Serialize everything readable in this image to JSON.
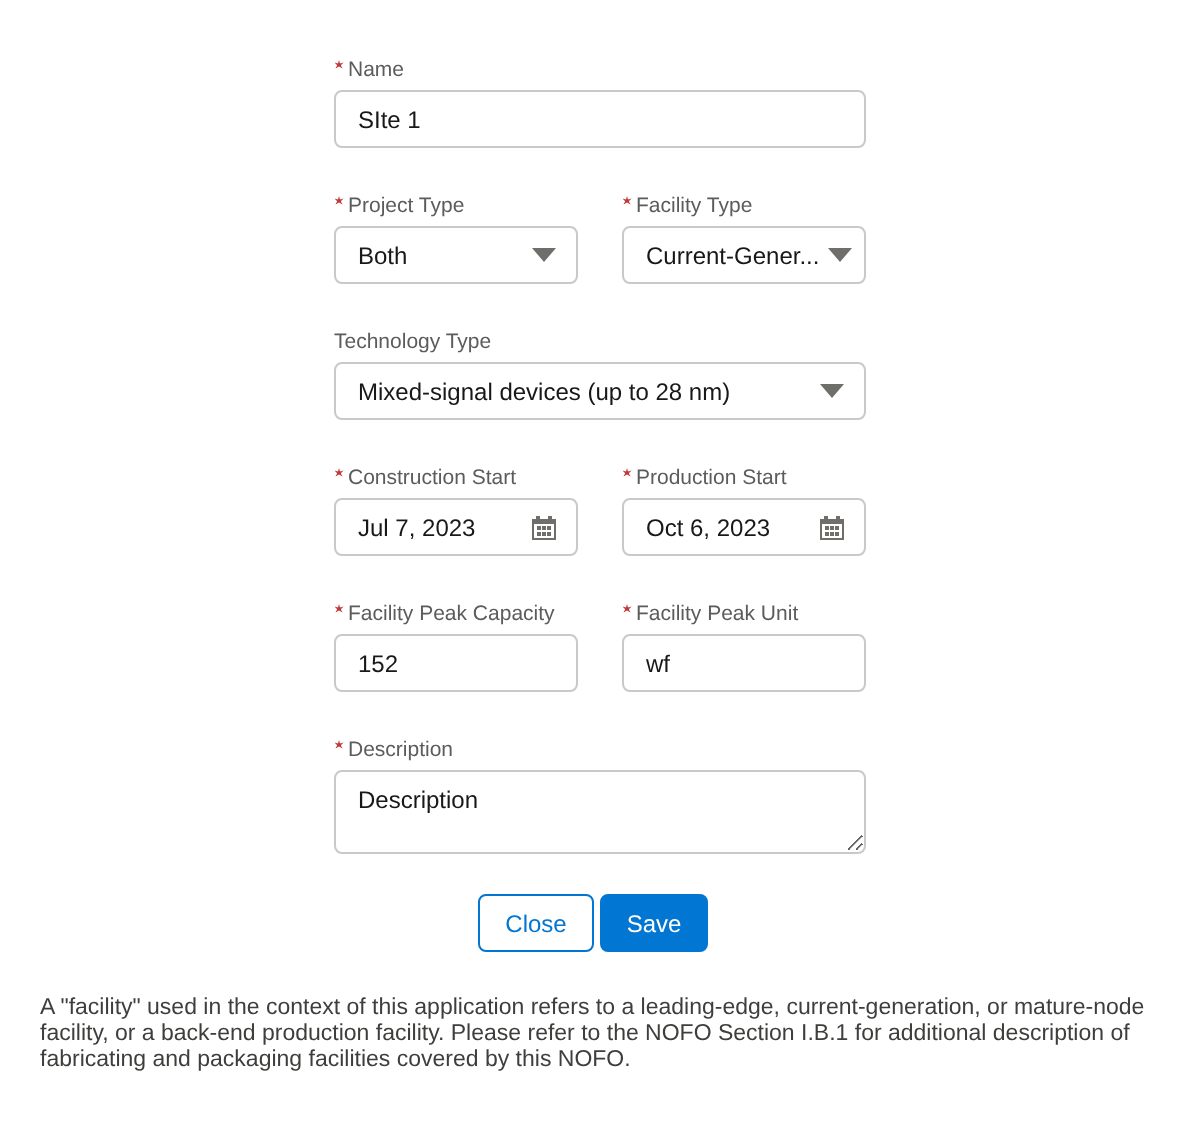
{
  "form": {
    "rows": [
      {
        "fields": [
          {
            "kind": "text",
            "label": "Name",
            "required": true,
            "value": "SIte 1"
          }
        ]
      },
      {
        "fields": [
          {
            "kind": "select",
            "label": "Project Type",
            "required": true,
            "value": "Both"
          },
          {
            "kind": "select",
            "label": "Facility Type",
            "required": true,
            "value": "Current-Gener..."
          }
        ]
      },
      {
        "fields": [
          {
            "kind": "select",
            "label": "Technology Type",
            "required": false,
            "value": "Mixed-signal devices (up to 28 nm)"
          }
        ]
      },
      {
        "fields": [
          {
            "kind": "date",
            "label": "Construction Start",
            "required": true,
            "value": "Jul 7, 2023"
          },
          {
            "kind": "date",
            "label": "Production Start",
            "required": true,
            "value": "Oct 6, 2023"
          }
        ]
      },
      {
        "fields": [
          {
            "kind": "text",
            "label": "Facility Peak Capacity",
            "required": true,
            "value": "152"
          },
          {
            "kind": "text",
            "label": "Facility Peak Unit",
            "required": true,
            "value": "wf"
          }
        ]
      },
      {
        "fields": [
          {
            "kind": "textarea",
            "label": "Description",
            "required": true,
            "value": "Description"
          }
        ]
      }
    ],
    "buttons": [
      {
        "label": "Close",
        "kind": "neutral"
      },
      {
        "label": "Save",
        "kind": "brand"
      }
    ]
  },
  "note": "A \"facility\" used in the context of this application refers to a leading-edge, current-generation, or mature-node facility, or a back-end production facility. Please refer to the NOFO Section I.B.1 for additional description of fabricating and packaging facilities covered by this NOFO."
}
